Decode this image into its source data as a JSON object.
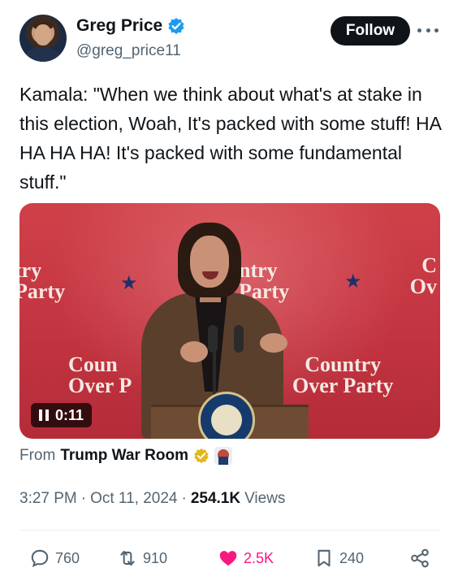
{
  "author": {
    "display_name": "Greg Price",
    "handle": "@greg_price11",
    "verified_icon": "verified-badge-icon",
    "follow_label": "Follow",
    "more_icon": "more-options-icon"
  },
  "tweet": {
    "text": "Kamala: \"When we think about what's at stake in this election, Woah, It's packed with some stuff! HA HA HA HA! It's packed with some fundamental stuff.\""
  },
  "media": {
    "video_time": "0:11",
    "play_state_icon": "pause-icon",
    "backdrop_slogans": [
      "try\nParty",
      "ntry\nParty",
      "C\nOv",
      "Coun\nOver P",
      "Country\nOver Party"
    ],
    "colors": {
      "backdrop": "#c23440",
      "star": "#1f2f6b"
    }
  },
  "attribution": {
    "from_label": "From",
    "source_name": "Trump War Room",
    "badge_icon": "gold-verified-badge-icon"
  },
  "meta": {
    "time": "3:27 PM",
    "separator": "·",
    "date": "Oct 11, 2024",
    "views_count": "254.1K",
    "views_label": "Views"
  },
  "actions": {
    "replies": "760",
    "reposts": "910",
    "likes": "2.5K",
    "bookmarks": "240"
  },
  "colors": {
    "accent_like": "#f91880",
    "verified_blue": "#1d9bf0",
    "gold": "#e2b719",
    "text_primary": "#0f1419",
    "text_secondary": "#536471"
  }
}
